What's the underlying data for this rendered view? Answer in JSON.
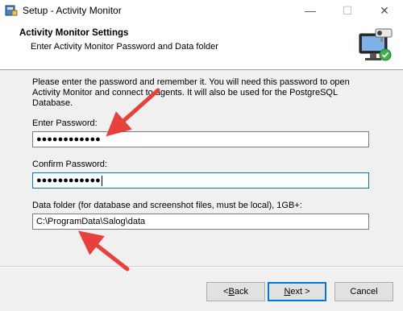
{
  "window": {
    "title": "Setup - Activity Monitor",
    "controls": {
      "minimize": "—",
      "maximize": "☐",
      "close": "✕"
    }
  },
  "header": {
    "title": "Activity Monitor Settings",
    "subtitle": "Enter Activity Monitor Password and Data folder"
  },
  "body": {
    "description": "Please enter the password and remember it. You will need this password to open Activity Monitor and connect to agents. It will also be used for the PostgreSQL Database.",
    "password_label": "Enter Password:",
    "password_value": "●●●●●●●●●●●●",
    "confirm_label": "Confirm Password:",
    "confirm_value": "●●●●●●●●●●●●",
    "folder_label": "Data folder (for database and screenshot files, must be local), 1GB+:",
    "folder_value": "C:\\ProgramData\\Salog\\data"
  },
  "buttons": {
    "back_prefix": "< ",
    "back_accel": "B",
    "back_rest": "ack",
    "next_accel": "N",
    "next_rest": "ext >",
    "cancel": "Cancel"
  },
  "colors": {
    "annotation_arrow": "#e8403a",
    "focus_border": "#0078d7"
  },
  "icons": {
    "app": "installer-icon",
    "logo": "monitor-camera-icon"
  }
}
